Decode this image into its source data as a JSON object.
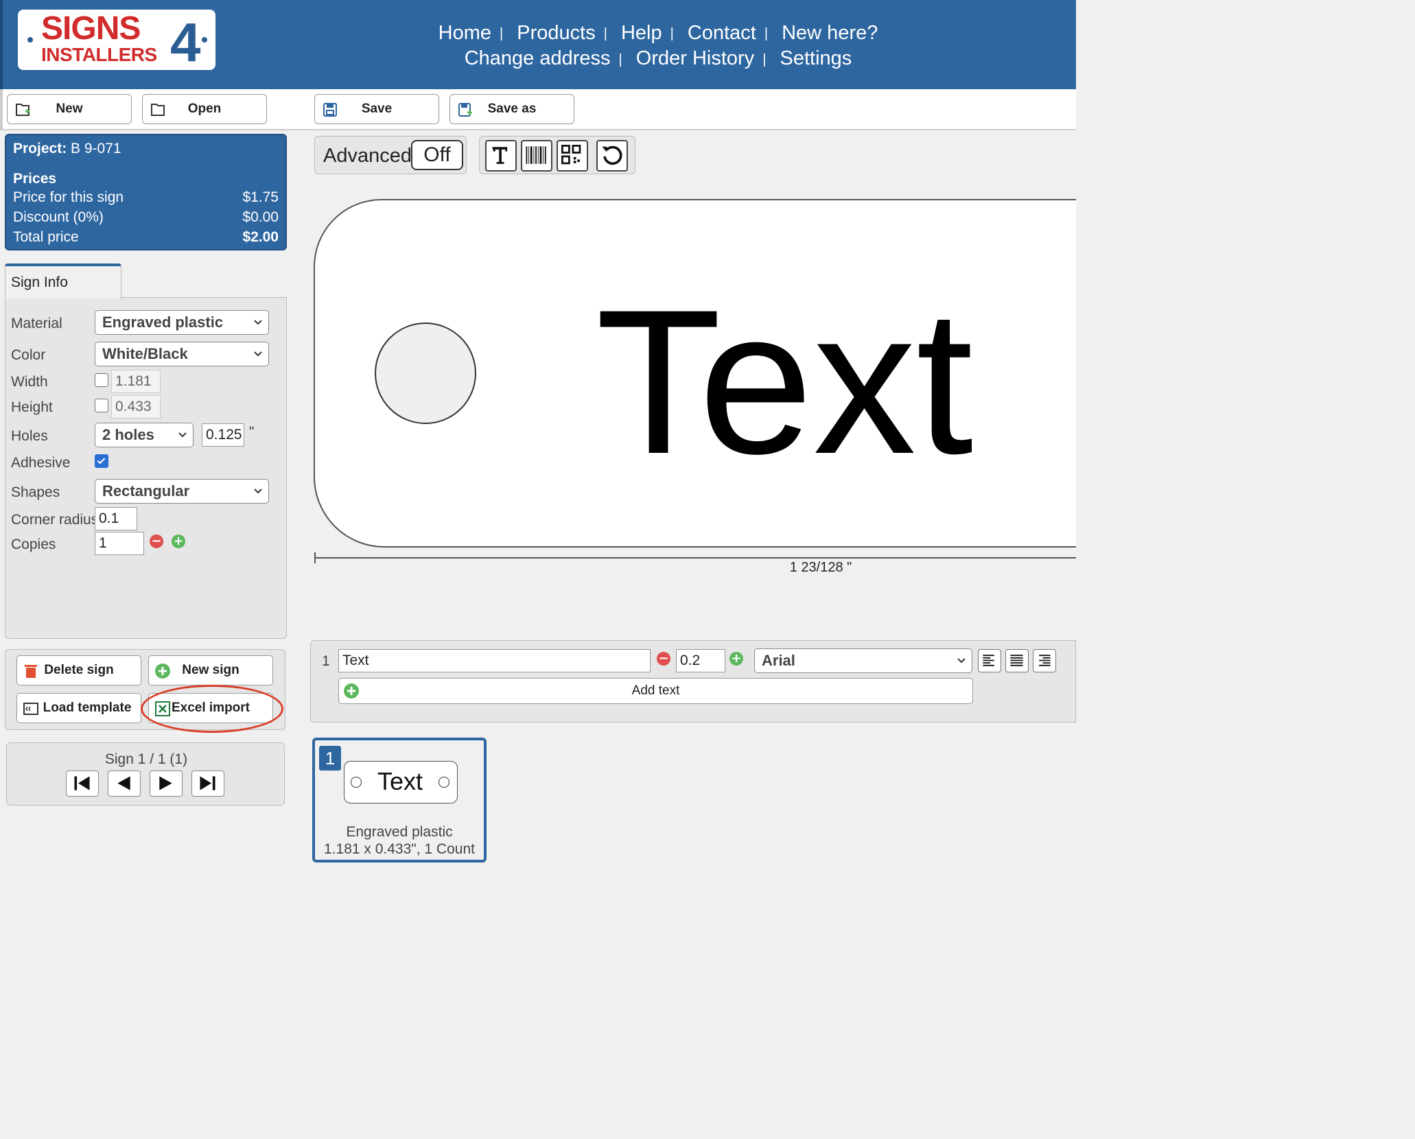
{
  "brand": {
    "line1": "SIGNS",
    "line2": "INSTALLERS",
    "digit": "4"
  },
  "nav": {
    "row1": [
      "Home",
      "Products",
      "Help",
      "Contact",
      "New here?"
    ],
    "row2": [
      "Change address",
      "Order History",
      "Settings"
    ],
    "separator": "|"
  },
  "toolbar": {
    "new": "New",
    "open": "Open",
    "save": "Save",
    "save_as": "Save as"
  },
  "project": {
    "label": "Project:",
    "name": "B 9-071",
    "prices_heading": "Prices",
    "price_label": "Price for this sign",
    "price_value": "$1.75",
    "discount_label": "Discount (0%)",
    "discount_value": "$0.00",
    "total_label": "Total price",
    "total_value": "$2.00"
  },
  "sign_info": {
    "tab": "Sign Info",
    "material_label": "Material",
    "material_value": "Engraved plastic",
    "color_label": "Color",
    "color_value": "White/Black",
    "width_label": "Width",
    "width_value": "1.181",
    "height_label": "Height",
    "height_value": "0.433",
    "holes_label": "Holes",
    "holes_value": "2 holes",
    "hole_size": "0.125",
    "hole_unit": "\"",
    "adhesive_label": "Adhesive",
    "adhesive_checked": true,
    "shapes_label": "Shapes",
    "shapes_value": "Rectangular",
    "corner_label": "Corner radius",
    "corner_value": "0.1",
    "copies_label": "Copies",
    "copies_value": "1"
  },
  "actions": {
    "delete": "Delete sign",
    "new_sign": "New sign",
    "load_template": "Load template",
    "excel_import": "Excel import"
  },
  "sign_nav": {
    "label": "Sign 1 / 1 (1)"
  },
  "editor": {
    "advanced_label": "Advanced",
    "advanced_state": "Off",
    "tools": [
      "text-tool-icon",
      "barcode-icon",
      "qr-code-icon",
      "undo-icon"
    ],
    "canvas_text": "Text",
    "dimension": "1 23/128 \""
  },
  "text_line": {
    "index": "1",
    "text": "Text",
    "size": "0.2",
    "font": "Arial",
    "add_text": "Add text"
  },
  "thumbnail": {
    "number": "1",
    "text": "Text",
    "material": "Engraved plastic",
    "details": "1.181 x 0.433\", 1 Count"
  },
  "colors": {
    "header_blue": "#2e66a0",
    "accent_red": "#d12b2b",
    "highlight_red": "#d9402b"
  }
}
